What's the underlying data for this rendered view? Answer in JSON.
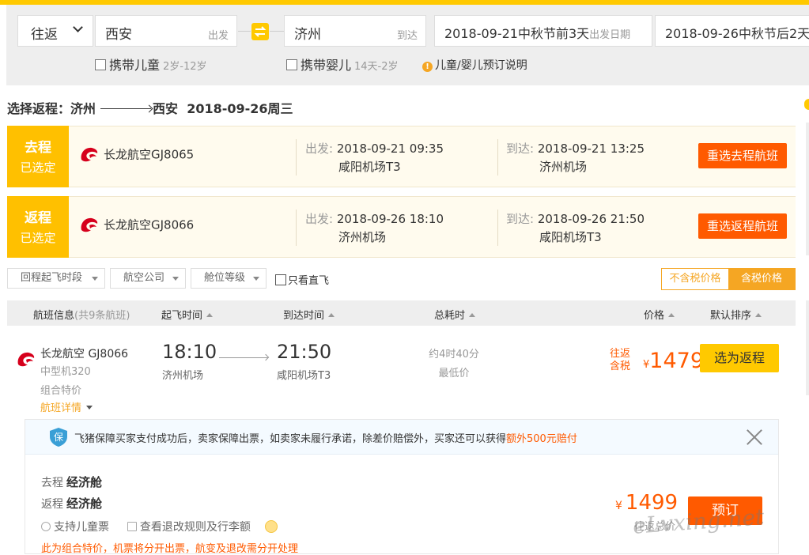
{
  "search": {
    "trip_type": "往返",
    "from_city": "西安",
    "from_tag": "出发",
    "to_city": "济州",
    "to_tag": "到达",
    "depart_date": "2018-09-21中秋节前3天",
    "depart_tag": "出发日期",
    "return_date": "2018-09-26中秋节后2天",
    "child_label": "携带儿童",
    "child_age": "2岁-12岁",
    "infant_label": "携带婴儿",
    "infant_age": "14天-2岁",
    "booking_note": "儿童/婴儿预订说明"
  },
  "section": {
    "prefix": "选择返程：",
    "from": "济州",
    "to": "西安",
    "date": "2018-09-26周三"
  },
  "legs": [
    {
      "type": "去程",
      "status": "已选定",
      "airline": "长龙航空GJ8065",
      "depart_label": "出发:",
      "depart_time": "2018-09-21 09:35",
      "depart_airport": "咸阳机场T3",
      "arrive_label": "到达:",
      "arrive_time": "2018-09-21 13:25",
      "arrive_airport": "济州机场",
      "button": "重选去程航班"
    },
    {
      "type": "返程",
      "status": "已选定",
      "airline": "长龙航空GJ8066",
      "depart_label": "出发:",
      "depart_time": "2018-09-26 18:10",
      "depart_airport": "济州机场",
      "arrive_label": "到达:",
      "arrive_time": "2018-09-26 21:50",
      "arrive_airport": "咸阳机场T3",
      "button": "重选返程航班"
    }
  ],
  "filters": {
    "time": "回程起飞时段",
    "airline": "航空公司",
    "cabin": "舱位等级",
    "direct": "只看直飞",
    "no_tax": "不含税价格",
    "with_tax": "含税价格"
  },
  "table": {
    "col_info": "航班信息",
    "col_count": "(共9条航班)",
    "col_depart": "起飞时间",
    "col_arrive": "到达时间",
    "col_duration": "总耗时",
    "col_price": "价格",
    "col_sort": "默认排序"
  },
  "flight": {
    "airline": "长龙航空 GJ8066",
    "model": "中型机320",
    "fare_type": "组合特价",
    "details": "航班详情",
    "depart_time": "18:10",
    "depart_airport": "济州机场",
    "arrive_time": "21:50",
    "arrive_airport": "咸阳机场T3",
    "duration": "约4时40分",
    "duration_note": "最低价",
    "price_label1": "往返",
    "price_label2": "含税",
    "currency": "¥",
    "price": "1479",
    "select": "选为返程"
  },
  "panel": {
    "guarantee_text": "飞猪保障买家支付成功后，卖家保障出票，如卖家未履行承诺，除差价赔偿外，买家还可以获得",
    "guarantee_highlight": "额外500元赔付",
    "outbound_label": "去程",
    "outbound_cabin": "经济舱",
    "return_label": "返程",
    "return_cabin": "经济舱",
    "child_ticket": "支持儿童票",
    "rules": "查看退改规则及行李额",
    "note": "此为组合特价，机票将分开出票，航变及退改需分开处理",
    "currency": "¥",
    "price": "1499",
    "price_label": "往返总价",
    "book": "预订"
  },
  "watermark": "eLvxing.net",
  "colors": {
    "brand_yellow": "#ffc900",
    "badge_yellow": "#ffc000",
    "accent_orange": "#ff5a00"
  }
}
